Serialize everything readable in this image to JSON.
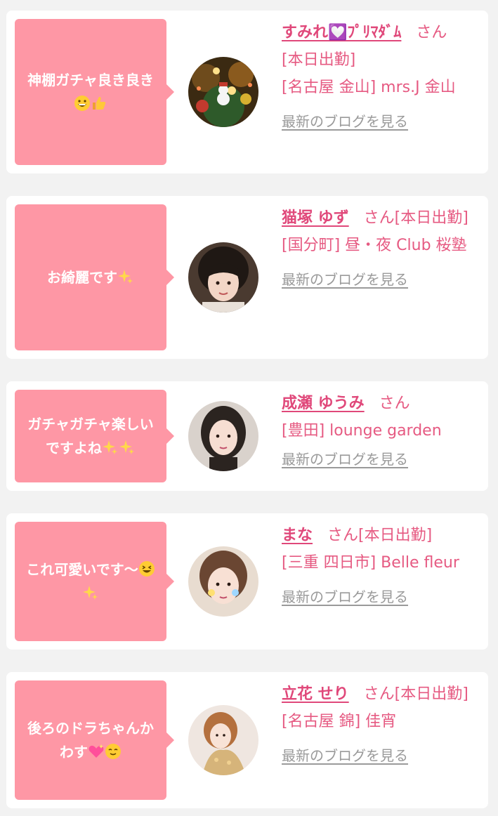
{
  "colors": {
    "bubble": "#fe97a5",
    "accent_text": "#e65a82",
    "link_gray": "#9a9a9a",
    "card_bg": "#ffffff",
    "page_bg": "#f2f2f2"
  },
  "comments": [
    {
      "text": "神棚ガチャ良き良き",
      "emoji_icons": [
        "grinning-face-icon",
        "thumbs-up-icon"
      ],
      "name": "すみれ💟ﾌﾟﾘﾏﾀﾞﾑ",
      "honorific": "さん",
      "status": "[本日出勤]",
      "shop": "[名古屋 金山] mrs.J 金山",
      "blog_link": "最新のブログを見る"
    },
    {
      "text": "お綺麗です",
      "emoji_icons": [
        "sparkles-icon"
      ],
      "name": "猫塚 ゆず",
      "honorific": "さん",
      "status": "[本日出勤]",
      "shop": "[国分町] 昼・夜 Club 桜塾",
      "blog_link": "最新のブログを見る"
    },
    {
      "text": "ガチャガチャ楽しいですよね",
      "emoji_icons": [
        "sparkles-icon",
        "sparkles-icon"
      ],
      "name": "成瀬 ゆうみ",
      "honorific": "さん",
      "status": "",
      "shop": "[豊田] lounge garden",
      "blog_link": "最新のブログを見る"
    },
    {
      "text": "これ可愛いです〜",
      "emoji_icons": [
        "laughing-face-icon",
        "sparkles-icon"
      ],
      "name": "まな",
      "honorific": "さん",
      "status": "[本日出勤]",
      "shop": "[三重 四日市] Belle fleur",
      "blog_link": "最新のブログを見る"
    },
    {
      "text": "後ろのドラちゃんかわす",
      "emoji_icons": [
        "sparkling-heart-icon",
        "relieved-face-icon"
      ],
      "name": "立花 せり",
      "honorific": "さん",
      "status": "[本日出勤]",
      "shop": "[名古屋 錦] 佳宵",
      "blog_link": "最新のブログを見る"
    }
  ]
}
